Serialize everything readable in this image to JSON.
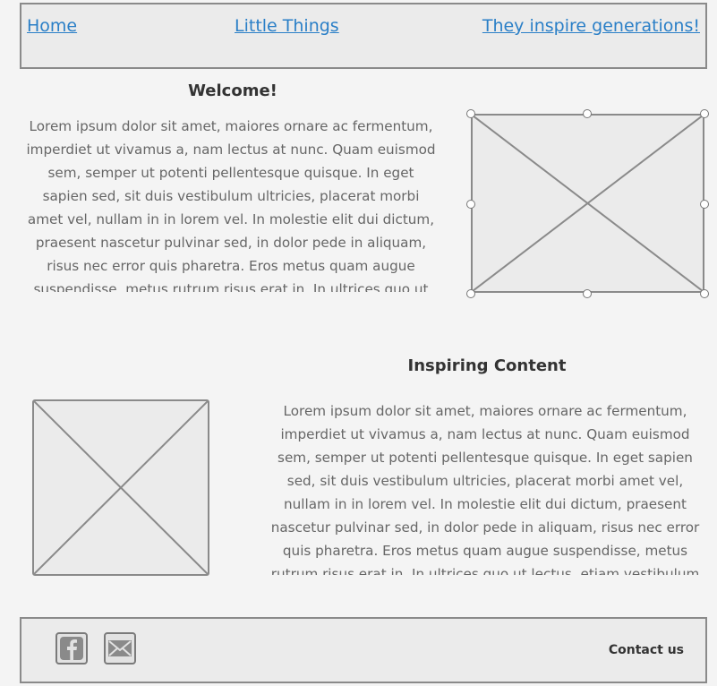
{
  "nav": {
    "home": "Home",
    "little_things": "Little Things",
    "inspire": "They inspire generations!"
  },
  "welcome": {
    "title": "Welcome!",
    "body": "Lorem ipsum dolor sit amet, maiores ornare ac fermentum, imperdiet ut vivamus a, nam lectus at nunc. Quam euismod sem, semper ut potenti pellentesque quisque. In eget sapien sed, sit duis vestibulum ultricies, placerat morbi amet vel, nullam in in lorem vel. In molestie elit dui dictum, praesent nascetur pulvinar sed, in dolor pede in aliquam, risus nec error quis pharetra. Eros metus quam augue suspendisse, metus rutrum risus erat in.  In ultrices quo ut lectus, etiam"
  },
  "inspiring": {
    "title": "Inspiring Content",
    "body": "Lorem ipsum dolor sit amet, maiores ornare ac fermentum, imperdiet ut vivamus a, nam lectus at nunc. Quam euismod sem, semper ut potenti pellentesque quisque. In eget sapien sed, sit duis vestibulum ultricies, placerat morbi amet vel, nullam in in lorem vel. In molestie elit dui dictum, praesent nascetur pulvinar sed, in dolor pede in aliquam, risus nec error quis pharetra. Eros metus quam augue suspendisse, metus rutrum risus erat in.  In ultrices quo ut lectus, etiam vestibulum urna a est, pretium luctus euismod"
  },
  "footer": {
    "social_icons": [
      "facebook-icon",
      "mail-icon"
    ],
    "contact": "Contact us"
  },
  "colors": {
    "link": "#2a7fc7",
    "border": "#8a8a8a",
    "panel": "#ebebeb",
    "background": "#f4f4f4"
  }
}
